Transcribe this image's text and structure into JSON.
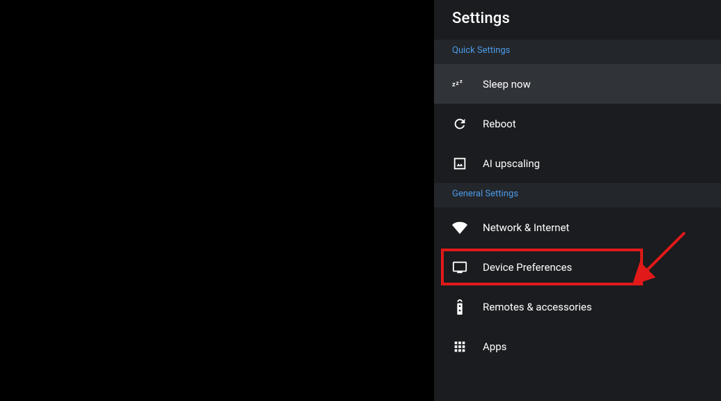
{
  "panel": {
    "title": "Settings",
    "sections": {
      "quick": {
        "header": "Quick Settings"
      },
      "general": {
        "header": "General Settings"
      }
    },
    "items": {
      "sleep": {
        "label": "Sleep now"
      },
      "reboot": {
        "label": "Reboot"
      },
      "aiup": {
        "label": "AI upscaling"
      },
      "network": {
        "label": "Network & Internet"
      },
      "deviceprefs": {
        "label": "Device Preferences"
      },
      "remotes": {
        "label": "Remotes & accessories"
      },
      "apps": {
        "label": "Apps"
      }
    }
  },
  "annotation": {
    "highlight_color": "#e11919"
  }
}
